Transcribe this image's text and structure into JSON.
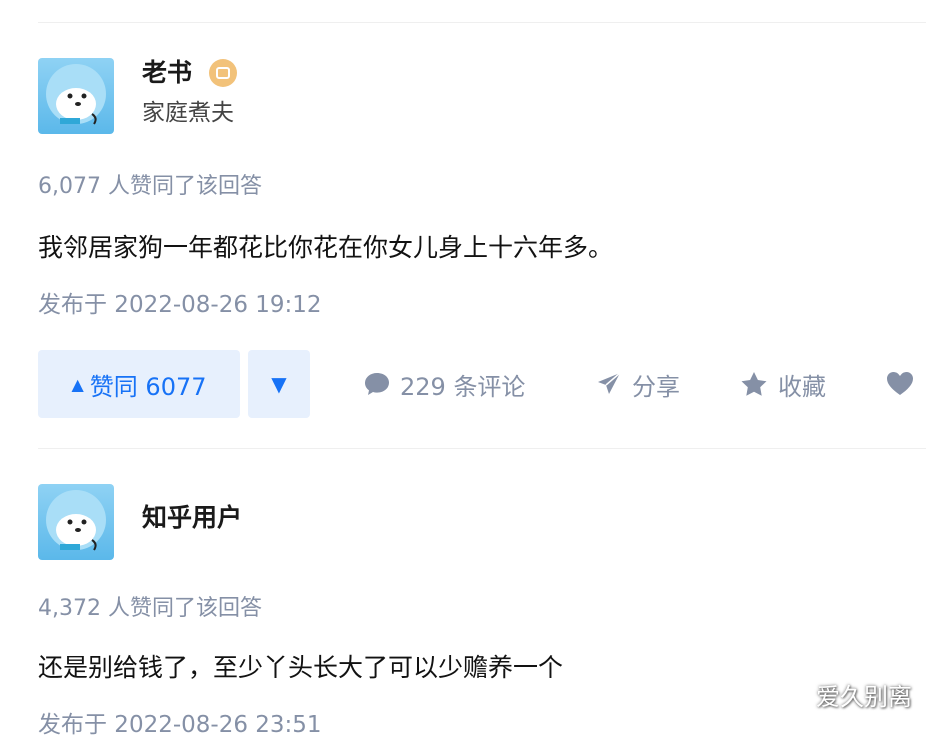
{
  "answers": [
    {
      "author_name": "老书",
      "author_bio": "家庭煮夫",
      "votes_text": "6,077 人赞同了该回答",
      "content": "我邻居家狗一年都花比你花在你女儿身上十六年多。",
      "published": "发布于 2022-08-26 19:12",
      "actions": {
        "upvote_label": "赞同 6077",
        "comments_label": "229 条评论",
        "share_label": "分享",
        "favorite_label": "收藏"
      }
    },
    {
      "author_name": "知乎用户",
      "votes_text": "4,372 人赞同了该回答",
      "content": "还是别给钱了，至少丫头长大了可以少赡养一个",
      "published": "发布于 2022-08-26 23:51"
    }
  ],
  "watermark": "爱久别离",
  "icons": {
    "upvote": "triangle-up-icon",
    "downvote": "triangle-down-icon",
    "comment": "comment-bubble-icon",
    "share": "paper-plane-icon",
    "favorite": "star-icon",
    "like": "heart-icon",
    "badge": "achievement-badge-icon"
  },
  "colors": {
    "accent": "#1772f6",
    "accent_bg": "#e7f0fd",
    "muted": "#8590a6",
    "badge": "#f2c27a"
  }
}
